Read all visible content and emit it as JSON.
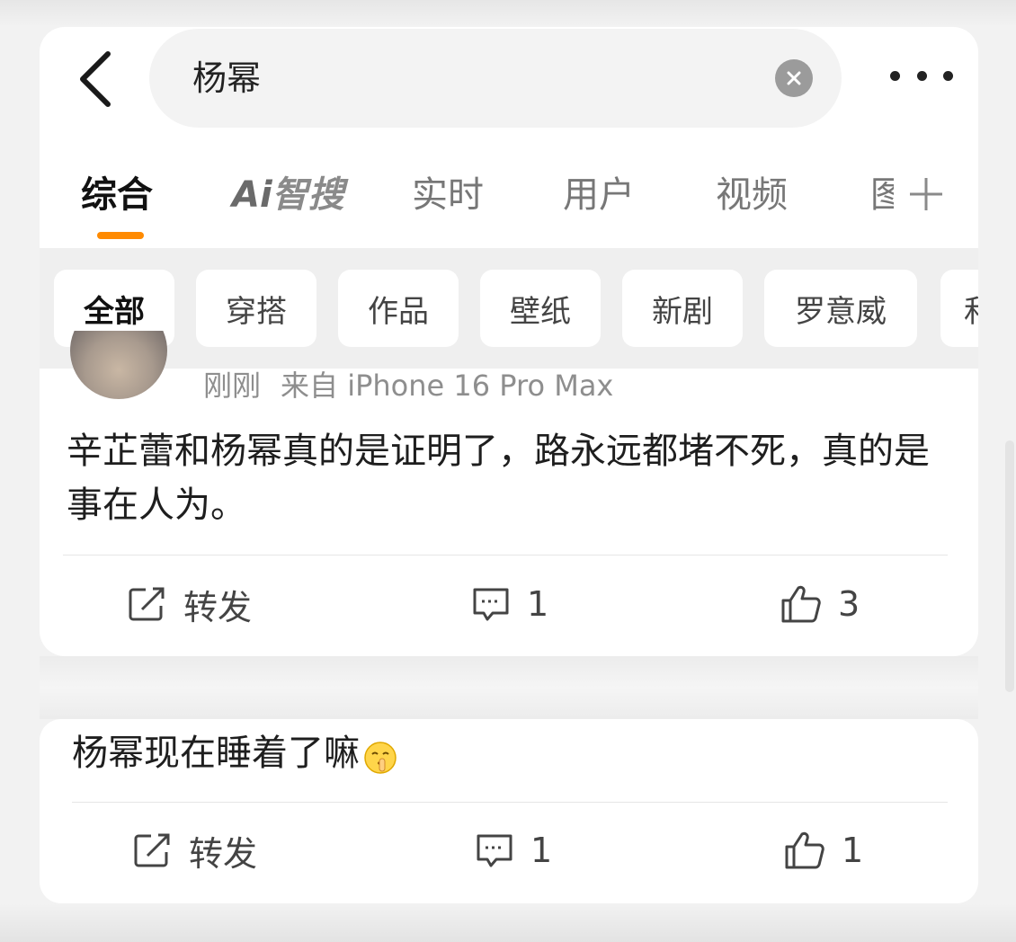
{
  "search": {
    "query": "杨幂"
  },
  "tabs": [
    {
      "label": "综合",
      "active": true
    },
    {
      "label_ai": "Ai",
      "label_rest": "智搜"
    },
    {
      "label": "实时"
    },
    {
      "label": "用户"
    },
    {
      "label": "视频"
    },
    {
      "label": "图"
    }
  ],
  "filters": [
    "全部",
    "穿搭",
    "作品",
    "壁纸",
    "新剧",
    "罗意威",
    "和"
  ],
  "post1": {
    "time": "刚刚",
    "source": "来自 iPhone 16 Pro Max",
    "text": "辛芷蕾和杨幂真的是证明了，路永远都堵不死，真的是事在人为。",
    "repost_label": "转发",
    "comments": "1",
    "likes": "3"
  },
  "post2": {
    "text": "杨幂现在睡着了嘛",
    "emoji": "shushing-face-emoji",
    "repost_label": "转发",
    "comments": "1",
    "likes": "1"
  },
  "colors": {
    "accent": "#ff8a00",
    "background": "#f2f2f2",
    "card": "#ffffff"
  },
  "icons": [
    "back-arrow-icon",
    "clear-icon",
    "more-icon",
    "plus-icon",
    "repost-icon",
    "comment-icon",
    "like-icon"
  ]
}
